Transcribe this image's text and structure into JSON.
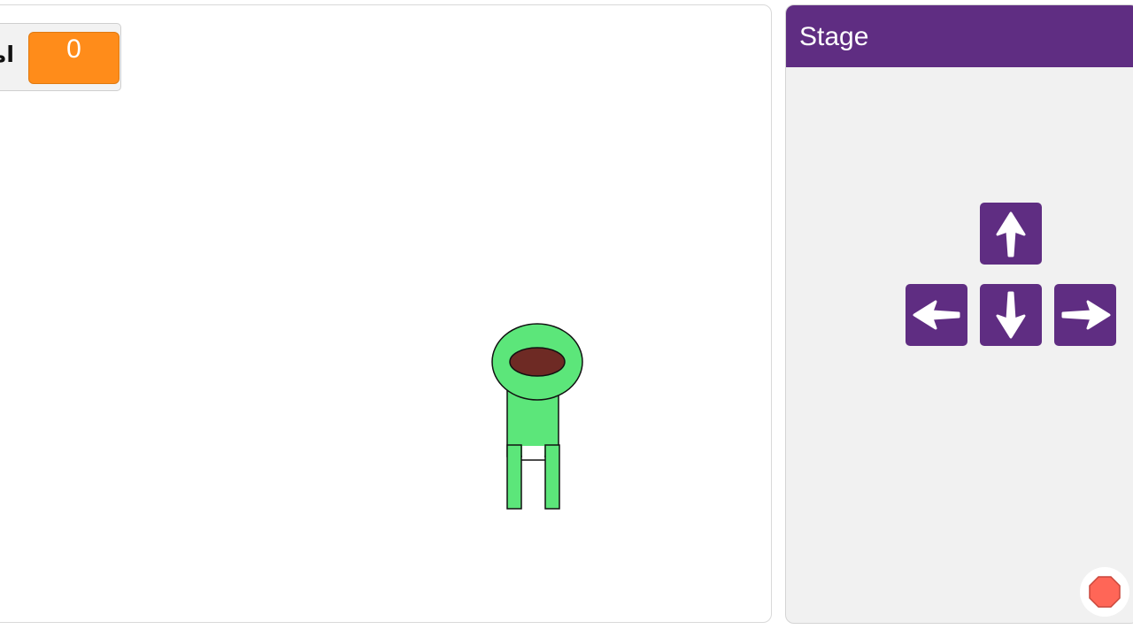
{
  "stage": {
    "score_monitor": {
      "label": "امتياز",
      "value": "0"
    },
    "sprite": {
      "name": "green-character",
      "body_color": "#5ce67a",
      "mouth_color": "#6e2a24"
    }
  },
  "panel": {
    "title": "Stage",
    "header_color": "#5f2d82",
    "arrow_keys": [
      {
        "direction": "up",
        "icon": "arrow-up-icon"
      },
      {
        "direction": "left",
        "icon": "arrow-left-icon"
      },
      {
        "direction": "down",
        "icon": "arrow-down-icon"
      },
      {
        "direction": "right",
        "icon": "arrow-right-icon"
      }
    ],
    "stop_button": {
      "icon": "stop-sign-icon",
      "color": "#ff6657"
    }
  }
}
